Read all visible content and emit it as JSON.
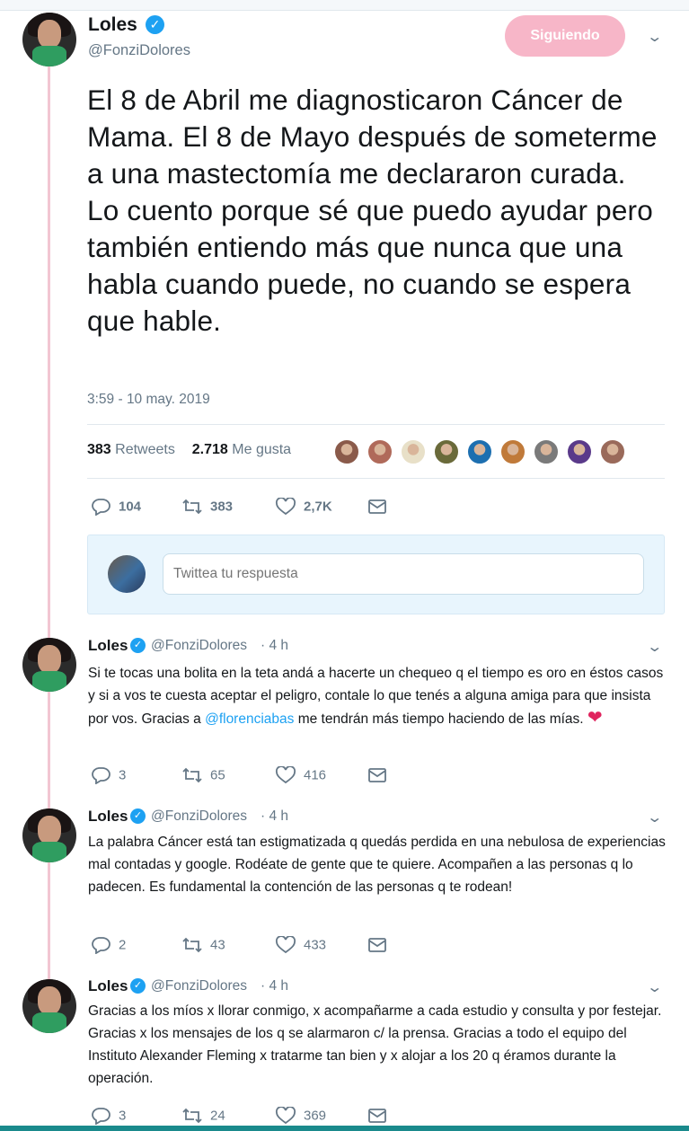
{
  "main_tweet": {
    "name": "Loles",
    "handle": "@FonziDolores",
    "follow_label": "Siguiendo",
    "text": "El 8 de Abril me diagnosticaron Cáncer de Mama. El 8 de Mayo después de someterme a una mastectomía me declararon curada. Lo cuento porque sé que puedo ayudar pero también entiendo más que nunca que una habla cuando puede, no cuando se espera que hable.",
    "timestamp": "3:59 - 10 may. 2019",
    "retweets_count": "383",
    "retweets_label": "Retweets",
    "likes_count": "2.718",
    "likes_label": "Me gusta",
    "replies": "104",
    "retweets": "383",
    "likes": "2,7K"
  },
  "liker_colors": [
    "#8a5a4a",
    "#b06a5a",
    "#e8e0c8",
    "#6a6a3a",
    "#1d6fb0",
    "#c07a3a",
    "#7a7a7a",
    "#5a3a8a",
    "#9a6a5a"
  ],
  "reply_box": {
    "placeholder": "Twittea tu respuesta"
  },
  "replies": [
    {
      "name": "Loles",
      "handle": "@FonziDolores",
      "time": "· 4 h",
      "text_before": "Si te tocas una bolita en la teta andá a hacerte un chequeo q el tiempo es oro en éstos casos y si a vos te cuesta aceptar el peligro, contale lo que tenés a alguna amiga para que insista por vos. Gracias a ",
      "mention": "@florenciabas",
      "text_after": " me tendrán más tiempo haciendo de las mías. ",
      "emoji": "❤",
      "reply_count": "3",
      "retweet_count": "65",
      "like_count": "416"
    },
    {
      "name": "Loles",
      "handle": "@FonziDolores",
      "time": "· 4 h",
      "text": "La palabra Cáncer está tan estigmatizada q quedás perdida en una nebulosa de experiencias mal contadas y google. Rodéate de gente que te quiere. Acompañen a las personas q lo padecen. Es fundamental la contención de las personas q te rodean!",
      "reply_count": "2",
      "retweet_count": "43",
      "like_count": "433"
    },
    {
      "name": "Loles",
      "handle": "@FonziDolores",
      "time": "· 4 h",
      "text": "Gracias a los míos x llorar conmigo, x acompañarme a cada estudio y consulta y por festejar. Gracias x los mensajes de los q se alarmaron c/ la prensa. Gracias a todo el equipo del Instituto Alexander Fleming x tratarme tan bien y x alojar a los 20 q éramos durante la operación.",
      "reply_count": "3",
      "retweet_count": "24",
      "like_count": "369"
    }
  ],
  "colors": {
    "verified": "#1da1f2",
    "follow_button": "#f7b6c8",
    "thread_line": "#f2c6d2",
    "heart": "#e0245e"
  }
}
